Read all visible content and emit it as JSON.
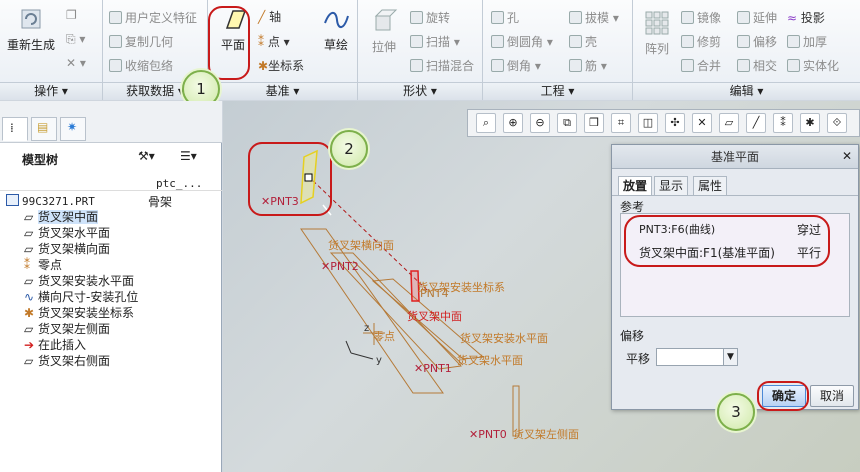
{
  "ribbon": {
    "ops": {
      "regen": "重新生成",
      "label": "操作"
    },
    "getdata": {
      "udf": "用户定义特征",
      "copygeom": "复制几何",
      "shrinkwrap": "收缩包络",
      "label": "获取数据"
    },
    "datum": {
      "plane": "平面",
      "axis": "轴",
      "point": "点",
      "csys": "坐标系",
      "sketch": "草绘",
      "label": "基准"
    },
    "shapes": {
      "extrude": "拉伸",
      "revolve": "旋转",
      "sweep": "扫描",
      "blend": "扫描混合",
      "label": "形状"
    },
    "engineering": {
      "hole": "孔",
      "round": "倒圆角",
      "chamfer": "倒角",
      "draft": "拔模",
      "shell": "壳",
      "rib": "筋",
      "label": "工程"
    },
    "editing": {
      "pattern": "阵列",
      "mirror": "镜像",
      "trim": "修剪",
      "merge": "合并",
      "extend": "延伸",
      "offset": "偏移",
      "intersect": "相交",
      "project": "投影",
      "thicken": "加厚",
      "solidify": "实体化",
      "label": "编辑"
    }
  },
  "tree": {
    "title": "模型树",
    "col1": "",
    "col2": "ptc_...",
    "root": "99C3271.PRT",
    "root_col2": "骨架",
    "items": [
      {
        "label": "货叉架中面",
        "icon": "plane-icon"
      },
      {
        "label": "货叉架水平面",
        "icon": "plane-icon"
      },
      {
        "label": "货叉架横向面",
        "icon": "plane-icon"
      },
      {
        "label": "零点",
        "icon": "point-icon"
      },
      {
        "label": "货叉架安装水平面",
        "icon": "plane-icon"
      },
      {
        "label": "横向尺寸-安装孔位",
        "icon": "curve-icon"
      },
      {
        "label": "货叉架安装坐标系",
        "icon": "csys-icon"
      },
      {
        "label": "货叉架左侧面",
        "icon": "plane-icon"
      },
      {
        "label": "在此插入",
        "icon": "insert-arrow-icon"
      },
      {
        "label": "货叉架右侧面",
        "icon": "plane-icon"
      }
    ]
  },
  "viewport": {
    "pnt3": "PNT3",
    "pnt2": "PNT2",
    "pnt1": "PNT1",
    "pnt0": "PNT0",
    "pnt4": "PNT4",
    "hengxiang": "货叉架横向面",
    "anzhuang_csys": "货叉架安装坐标系",
    "zhongmian": "货叉架中面",
    "anzhuang_shuiping": "货叉架安装水平面",
    "lingdian": "零点",
    "shuiping": "货叉架水平面",
    "zuoce": "货叉架左侧面",
    "z": "z",
    "y": "y"
  },
  "dialog": {
    "title": "基准平面",
    "tabs": [
      "放置",
      "显示",
      "属性"
    ],
    "ref_label": "参考",
    "refs": [
      {
        "name": "PNT3:F6(曲线)",
        "constraint": "穿过"
      },
      {
        "name": "货叉架中面:F1(基准平面)",
        "constraint": "平行"
      }
    ],
    "offset_label": "偏移",
    "translate_label": "平移",
    "ok": "确定",
    "cancel": "取消"
  },
  "callouts": [
    "1",
    "2",
    "3"
  ],
  "colors": {
    "accent_red": "#c81a1a",
    "annotation": "#c27a2a",
    "ok_blue": "#4b89d6"
  }
}
